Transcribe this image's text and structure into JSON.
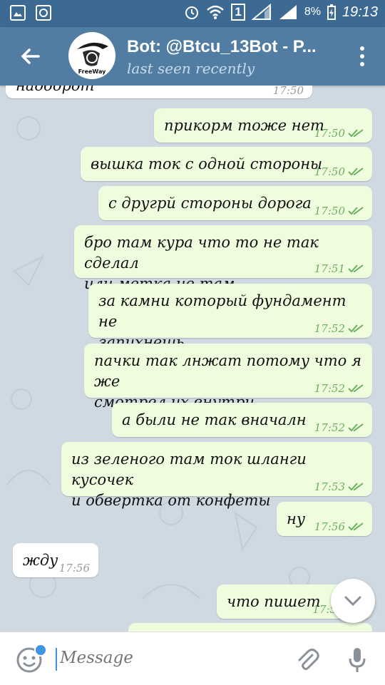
{
  "status_bar": {
    "battery": "8%",
    "time": "19:13",
    "sim": "1"
  },
  "header": {
    "title": "Bot: @Btcu_13Bot - P...",
    "subtitle": "last seen recently",
    "avatar_text": "FreeWay"
  },
  "messages": [
    {
      "id": 0,
      "side": "in",
      "text": "наоборот",
      "time": "17:50"
    },
    {
      "id": 1,
      "side": "out",
      "text": "прикорм тоже нет",
      "time": "17:50"
    },
    {
      "id": 2,
      "side": "out",
      "text": "вышка ток с одной стороны",
      "time": "17:50"
    },
    {
      "id": 3,
      "side": "out",
      "text": "с другрй стороны дорога",
      "time": "17:50"
    },
    {
      "id": 4,
      "side": "out",
      "text": "бро там кура что то не так сделал\nили метка не там",
      "time": "17:51"
    },
    {
      "id": 5,
      "side": "out",
      "text": "за камни который фундамент не\nзапихнешь",
      "time": "17:52"
    },
    {
      "id": 6,
      "side": "out",
      "text": "пачки так лнжат потому что я же\nсмотрел их внутри",
      "time": "17:52"
    },
    {
      "id": 7,
      "side": "out",
      "text": "а были не так вначалн",
      "time": "17:52"
    },
    {
      "id": 8,
      "side": "out",
      "text": "из зеленого там ток шланги кусочек\nи обвертка от конфеты",
      "time": "17:53"
    },
    {
      "id": 9,
      "side": "out",
      "text": "ну",
      "time": "17:56"
    },
    {
      "id": 10,
      "side": "in",
      "text": "жду",
      "time": "17:56"
    },
    {
      "id": 11,
      "side": "out",
      "text": "что пишет",
      "time": "17:5"
    }
  ],
  "input": {
    "placeholder": "Message"
  },
  "colors": {
    "header": "#517da2",
    "statusbar": "#3d6a92",
    "outgoing": "#effdde",
    "check": "#6cb05f",
    "accent": "#3f95e0"
  },
  "icons": [
    "back-arrow-icon",
    "more-vert-icon",
    "chevron-down-icon",
    "emoji-icon",
    "attach-icon",
    "mic-icon",
    "double-check-icon"
  ]
}
